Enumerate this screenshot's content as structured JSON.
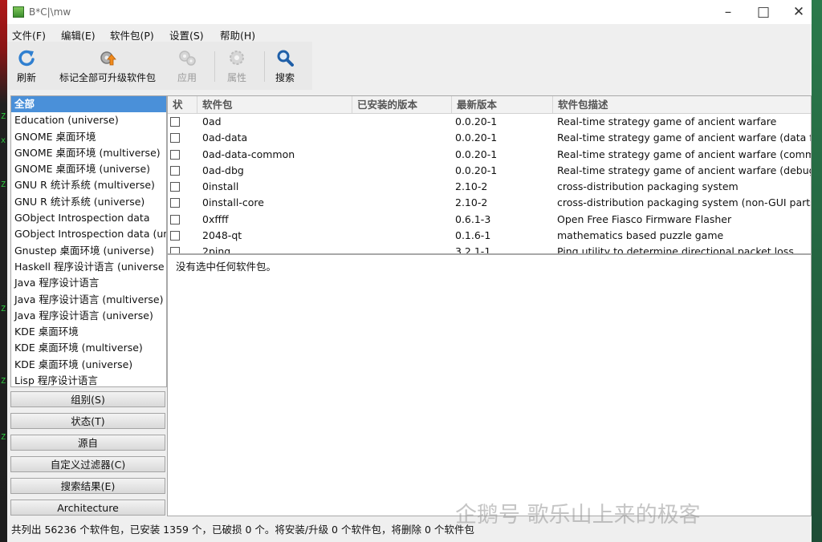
{
  "window": {
    "title": "B*C|\\mw"
  },
  "menu": [
    "文件(F)",
    "编辑(E)",
    "软件包(P)",
    "设置(S)",
    "帮助(H)"
  ],
  "toolbar": {
    "refresh": "刷新",
    "mark_upgrades": "标记全部可升级软件包",
    "apply": "应用",
    "properties": "属性",
    "search": "搜索"
  },
  "sections": [
    "全部",
    "Education (universe)",
    "GNOME 桌面环境",
    "GNOME 桌面环境 (multiverse)",
    "GNOME 桌面环境 (universe)",
    "GNU R 统计系统 (multiverse)",
    "GNU R 统计系统 (universe)",
    "GObject Introspection data",
    "GObject Introspection data (un",
    "Gnustep 桌面环境 (universe)",
    "Haskell 程序设计语言 (universe",
    "Java 程序设计语言",
    "Java 程序设计语言 (multiverse)",
    "Java 程序设计语言 (universe)",
    "KDE 桌面环境",
    "KDE 桌面环境 (multiverse)",
    "KDE 桌面环境 (universe)",
    "Lisp 程序设计语言"
  ],
  "filter_buttons": [
    "组别(S)",
    "状态(T)",
    "源自",
    "自定义过滤器(C)",
    "搜索结果(E)",
    "Architecture"
  ],
  "columns": {
    "status": "状",
    "package": "软件包",
    "installed": "已安装的版本",
    "latest": "最新版本",
    "description": "软件包描述"
  },
  "packages": [
    {
      "name": "0ad",
      "installed": "",
      "latest": "0.0.20-1",
      "desc": "Real-time strategy game of ancient warfare"
    },
    {
      "name": "0ad-data",
      "installed": "",
      "latest": "0.0.20-1",
      "desc": "Real-time strategy game of ancient warfare (data fil"
    },
    {
      "name": "0ad-data-common",
      "installed": "",
      "latest": "0.0.20-1",
      "desc": "Real-time strategy game of ancient warfare (comm"
    },
    {
      "name": "0ad-dbg",
      "installed": "",
      "latest": "0.0.20-1",
      "desc": "Real-time strategy game of ancient warfare (debug)"
    },
    {
      "name": "0install",
      "installed": "",
      "latest": "2.10-2",
      "desc": "cross-distribution packaging system"
    },
    {
      "name": "0install-core",
      "installed": "",
      "latest": "2.10-2",
      "desc": "cross-distribution packaging system (non-GUI parts"
    },
    {
      "name": "0xffff",
      "installed": "",
      "latest": "0.6.1-3",
      "desc": "Open Free Fiasco Firmware Flasher"
    },
    {
      "name": "2048-qt",
      "installed": "",
      "latest": "0.1.6-1",
      "desc": "mathematics based puzzle game"
    },
    {
      "name": "2ping",
      "installed": "",
      "latest": "3.2.1-1",
      "desc": "Ping utility to determine directional packet loss"
    }
  ],
  "detail": {
    "text": "没有选中任何软件包。"
  },
  "status": {
    "text": "共列出 56236 个软件包，已安装 1359 个，已破损 0 个。将安装/升级 0 个软件包，将删除 0 个软件包"
  },
  "watermark": {
    "text": "企鹅号 歌乐山上来的极客"
  },
  "colors": {
    "selection": "#4a90d9",
    "refresh_icon": "#2f7fd0",
    "search_icon": "#1f5fa8"
  }
}
